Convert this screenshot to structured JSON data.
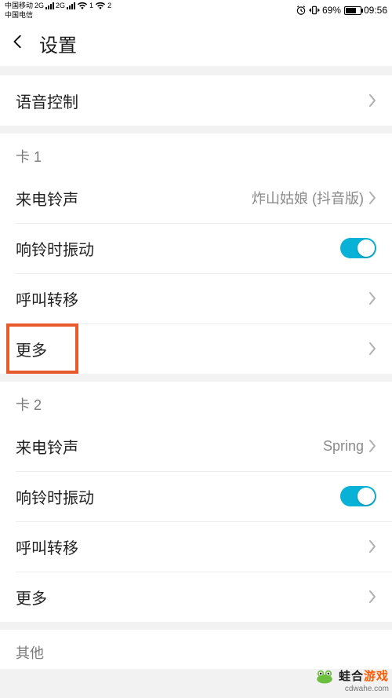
{
  "status": {
    "carrier1": "中国移动",
    "carrier2": "中国电信",
    "net1": "2G",
    "net2": "2G",
    "wifi_badge1": "1",
    "wifi_badge2": "2",
    "battery_pct": "69%",
    "time": "09:56"
  },
  "header": {
    "title": "设置"
  },
  "rows": {
    "voice_control": "语音控制",
    "sim1_header": "卡 1",
    "sim1_ringtone": "来电铃声",
    "sim1_ringtone_value": "炸山姑娘 (抖音版)",
    "sim1_vibrate": "响铃时振动",
    "sim1_forward": "呼叫转移",
    "sim1_more": "更多",
    "sim2_header": "卡 2",
    "sim2_ringtone": "来电铃声",
    "sim2_ringtone_value": "Spring",
    "sim2_vibrate": "响铃时振动",
    "sim2_forward": "呼叫转移",
    "sim2_more": "更多",
    "other_header": "其他"
  },
  "toggles": {
    "sim1_vibrate_on": true,
    "sim2_vibrate_on": true
  },
  "watermark": {
    "brand_a": "蛙合",
    "brand_b": "游戏",
    "url": "cdwahe.com"
  }
}
